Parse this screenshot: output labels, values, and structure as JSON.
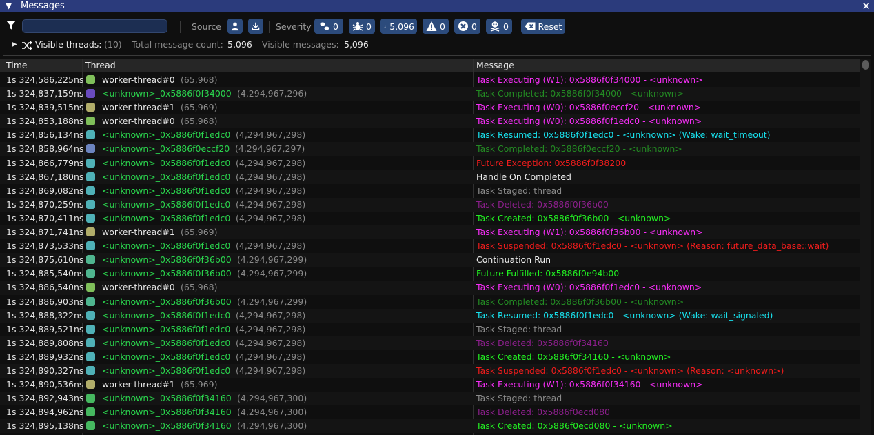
{
  "window": {
    "title": "Messages"
  },
  "filter": {
    "value": "",
    "placeholder": ""
  },
  "toolbar": {
    "source_label": "Source",
    "severity_label": "Severity",
    "severity_counts": {
      "trace": "0",
      "debug": "0",
      "info": "5,096",
      "warning": "0",
      "error": "0",
      "fatal": "0"
    },
    "reset_label": "Reset"
  },
  "stats": {
    "visible_threads_label": "Visible threads:",
    "visible_threads_value": "(10)",
    "total_label": "Total message count:",
    "total_value": "5,096",
    "visible_label": "Visible messages:",
    "visible_value": "5,096"
  },
  "columns": {
    "time": "Time",
    "thread": "Thread",
    "message": "Message"
  },
  "colors": {
    "title_bar": "#2b3b7c",
    "button_bg": "#2c4b7c",
    "unknown_thread_text": "#2ad44d",
    "worker_thread_text": "#e8e8e8",
    "msg_magenta": "#f52ef5",
    "msg_dim_green": "#238a23",
    "msg_cyan": "#18e0ec",
    "msg_red": "#ee1c1c",
    "msg_white": "#ededed",
    "msg_gray": "#8a8a8a",
    "msg_purple": "#8b1f8b",
    "msg_green": "#22ee22"
  },
  "rows": [
    {
      "time": "1s 324,586,225ns",
      "swatch": "#7fbf5a",
      "thread": "worker-thread#0",
      "tid": "(65,968)",
      "kind": "worker",
      "msg": "Task Executing (W1): 0x5886f0f34000 - <unknown>",
      "mc": "#f52ef5"
    },
    {
      "time": "1s 324,837,159ns",
      "swatch": "#6a4bbf",
      "thread": "<unknown>_0x5886f0f34000",
      "tid": "(4,294,967,296)",
      "kind": "unknown",
      "msg": "Task Completed: 0x5886f0f34000 - <unknown>",
      "mc": "#238a23"
    },
    {
      "time": "1s 324,839,515ns",
      "swatch": "#b1ad6a",
      "thread": "worker-thread#1",
      "tid": "(65,969)",
      "kind": "worker",
      "msg": "Task Executing (W0): 0x5886f0eccf20 - <unknown>",
      "mc": "#f52ef5"
    },
    {
      "time": "1s 324,853,188ns",
      "swatch": "#7fbf5a",
      "thread": "worker-thread#0",
      "tid": "(65,968)",
      "kind": "worker",
      "msg": "Task Executing (W0): 0x5886f0f1edc0 - <unknown>",
      "mc": "#f52ef5"
    },
    {
      "time": "1s 324,856,134ns",
      "swatch": "#4fb1b7",
      "thread": "<unknown>_0x5886f0f1edc0",
      "tid": "(4,294,967,298)",
      "kind": "unknown",
      "msg": "Task Resumed: 0x5886f0f1edc0 - <unknown> (Wake: wait_timeout)",
      "mc": "#18e0ec"
    },
    {
      "time": "1s 324,858,964ns",
      "swatch": "#6c84bf",
      "thread": "<unknown>_0x5886f0eccf20",
      "tid": "(4,294,967,297)",
      "kind": "unknown",
      "msg": "Task Completed: 0x5886f0eccf20 - <unknown>",
      "mc": "#238a23"
    },
    {
      "time": "1s 324,866,779ns",
      "swatch": "#4fb1b7",
      "thread": "<unknown>_0x5886f0f1edc0",
      "tid": "(4,294,967,298)",
      "kind": "unknown",
      "msg": "Future Exception: 0x5886f0f38200",
      "mc": "#ee1c1c"
    },
    {
      "time": "1s 324,867,180ns",
      "swatch": "#4fb1b7",
      "thread": "<unknown>_0x5886f0f1edc0",
      "tid": "(4,294,967,298)",
      "kind": "unknown",
      "msg": "Handle On Completed",
      "mc": "#ededed"
    },
    {
      "time": "1s 324,869,082ns",
      "swatch": "#4fb1b7",
      "thread": "<unknown>_0x5886f0f1edc0",
      "tid": "(4,294,967,298)",
      "kind": "unknown",
      "msg": "Task Staged: thread",
      "mc": "#8a8a8a"
    },
    {
      "time": "1s 324,870,259ns",
      "swatch": "#4fb1b7",
      "thread": "<unknown>_0x5886f0f1edc0",
      "tid": "(4,294,967,298)",
      "kind": "unknown",
      "msg": "Task Deleted: 0x5886f0f36b00",
      "mc": "#8b1f8b"
    },
    {
      "time": "1s 324,870,411ns",
      "swatch": "#4fb1b7",
      "thread": "<unknown>_0x5886f0f1edc0",
      "tid": "(4,294,967,298)",
      "kind": "unknown",
      "msg": "Task Created: 0x5886f0f36b00 - <unknown>",
      "mc": "#22ee22"
    },
    {
      "time": "1s 324,871,741ns",
      "swatch": "#b1ad6a",
      "thread": "worker-thread#1",
      "tid": "(65,969)",
      "kind": "worker",
      "msg": "Task Executing (W1): 0x5886f0f36b00 - <unknown>",
      "mc": "#f52ef5"
    },
    {
      "time": "1s 324,873,533ns",
      "swatch": "#4fb1b7",
      "thread": "<unknown>_0x5886f0f1edc0",
      "tid": "(4,294,967,298)",
      "kind": "unknown",
      "msg": "Task Suspended: 0x5886f0f1edc0 - <unknown> (Reason: future_data_base::wait)",
      "mc": "#ee1c1c"
    },
    {
      "time": "1s 324,875,610ns",
      "swatch": "#4fb58f",
      "thread": "<unknown>_0x5886f0f36b00",
      "tid": "(4,294,967,299)",
      "kind": "unknown",
      "msg": "Continuation Run",
      "mc": "#ededed"
    },
    {
      "time": "1s 324,885,540ns",
      "swatch": "#4fb58f",
      "thread": "<unknown>_0x5886f0f36b00",
      "tid": "(4,294,967,299)",
      "kind": "unknown",
      "msg": "Future Fulfilled: 0x5886f0e94b00",
      "mc": "#22ee22"
    },
    {
      "time": "1s 324,886,540ns",
      "swatch": "#7fbf5a",
      "thread": "worker-thread#0",
      "tid": "(65,968)",
      "kind": "worker",
      "msg": "Task Executing (W0): 0x5886f0f1edc0 - <unknown>",
      "mc": "#f52ef5"
    },
    {
      "time": "1s 324,886,903ns",
      "swatch": "#4fb58f",
      "thread": "<unknown>_0x5886f0f36b00",
      "tid": "(4,294,967,299)",
      "kind": "unknown",
      "msg": "Task Completed: 0x5886f0f36b00 - <unknown>",
      "mc": "#238a23"
    },
    {
      "time": "1s 324,888,322ns",
      "swatch": "#4fb1b7",
      "thread": "<unknown>_0x5886f0f1edc0",
      "tid": "(4,294,967,298)",
      "kind": "unknown",
      "msg": "Task Resumed: 0x5886f0f1edc0 - <unknown> (Wake: wait_signaled)",
      "mc": "#18e0ec"
    },
    {
      "time": "1s 324,889,521ns",
      "swatch": "#4fb1b7",
      "thread": "<unknown>_0x5886f0f1edc0",
      "tid": "(4,294,967,298)",
      "kind": "unknown",
      "msg": "Task Staged: thread",
      "mc": "#8a8a8a"
    },
    {
      "time": "1s 324,889,808ns",
      "swatch": "#4fb1b7",
      "thread": "<unknown>_0x5886f0f1edc0",
      "tid": "(4,294,967,298)",
      "kind": "unknown",
      "msg": "Task Deleted: 0x5886f0f34160",
      "mc": "#8b1f8b"
    },
    {
      "time": "1s 324,889,932ns",
      "swatch": "#4fb1b7",
      "thread": "<unknown>_0x5886f0f1edc0",
      "tid": "(4,294,967,298)",
      "kind": "unknown",
      "msg": "Task Created: 0x5886f0f34160 - <unknown>",
      "mc": "#22ee22"
    },
    {
      "time": "1s 324,890,327ns",
      "swatch": "#4fb1b7",
      "thread": "<unknown>_0x5886f0f1edc0",
      "tid": "(4,294,967,298)",
      "kind": "unknown",
      "msg": "Task Suspended: 0x5886f0f1edc0 - <unknown> (Reason: <unknown>)",
      "mc": "#ee1c1c"
    },
    {
      "time": "1s 324,890,536ns",
      "swatch": "#b1ad6a",
      "thread": "worker-thread#1",
      "tid": "(65,969)",
      "kind": "worker",
      "msg": "Task Executing (W1): 0x5886f0f34160 - <unknown>",
      "mc": "#f52ef5"
    },
    {
      "time": "1s 324,892,943ns",
      "swatch": "#46b860",
      "thread": "<unknown>_0x5886f0f34160",
      "tid": "(4,294,967,300)",
      "kind": "unknown",
      "msg": "Task Staged: thread",
      "mc": "#8a8a8a"
    },
    {
      "time": "1s 324,894,962ns",
      "swatch": "#46b860",
      "thread": "<unknown>_0x5886f0f34160",
      "tid": "(4,294,967,300)",
      "kind": "unknown",
      "msg": "Task Deleted: 0x5886f0ecd080",
      "mc": "#8b1f8b"
    },
    {
      "time": "1s 324,895,138ns",
      "swatch": "#46b860",
      "thread": "<unknown>_0x5886f0f34160",
      "tid": "(4,294,967,300)",
      "kind": "unknown",
      "msg": "Task Created: 0x5886f0ecd080 - <unknown>",
      "mc": "#22ee22"
    }
  ]
}
